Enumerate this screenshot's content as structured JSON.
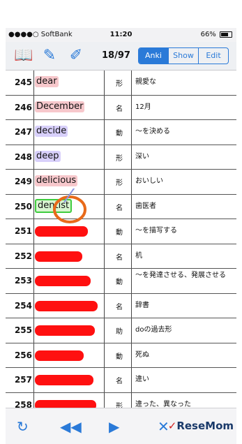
{
  "status": {
    "carrier": "●●●●○ SoftBank",
    "time": "11:20",
    "battery": "66%"
  },
  "toolbar": {
    "counter": "18/97",
    "modes": [
      "Anki",
      "Show",
      "Edit"
    ]
  },
  "rows": [
    {
      "num": "245",
      "word": "dear",
      "pos": "形",
      "meaning": "親愛な",
      "color": "#f7c8cc"
    },
    {
      "num": "246",
      "word": "December",
      "pos": "名",
      "meaning": "12月",
      "color": "#f7c8cc"
    },
    {
      "num": "247",
      "word": "decide",
      "pos": "動",
      "meaning": "〜を決める",
      "color": "#d8d0fb"
    },
    {
      "num": "248",
      "word": "deep",
      "pos": "形",
      "meaning": "深い",
      "color": "#d8d0fb"
    },
    {
      "num": "249",
      "word": "delicious",
      "pos": "形",
      "meaning": "おいしい",
      "color": "#f7c8cc"
    },
    {
      "num": "250",
      "word": "dentist",
      "pos": "名",
      "meaning": "歯医者",
      "color": "#d8f5d0"
    },
    {
      "num": "251",
      "word": "",
      "pos": "動",
      "meaning": "〜を描写する"
    },
    {
      "num": "252",
      "word": "",
      "pos": "名",
      "meaning": "机"
    },
    {
      "num": "253",
      "word": "",
      "pos": "動",
      "meaning": "〜を発達させる、発展させる"
    },
    {
      "num": "254",
      "word": "",
      "pos": "名",
      "meaning": "辞書"
    },
    {
      "num": "255",
      "word": "",
      "pos": "助",
      "meaning": "doの過去形"
    },
    {
      "num": "256",
      "word": "",
      "pos": "動",
      "meaning": "死ぬ"
    },
    {
      "num": "257",
      "word": "",
      "pos": "名",
      "meaning": "違い"
    },
    {
      "num": "258",
      "word": "",
      "pos": "形",
      "meaning": "違った、異なった"
    }
  ],
  "watermark": {
    "text": "ReseMom"
  }
}
